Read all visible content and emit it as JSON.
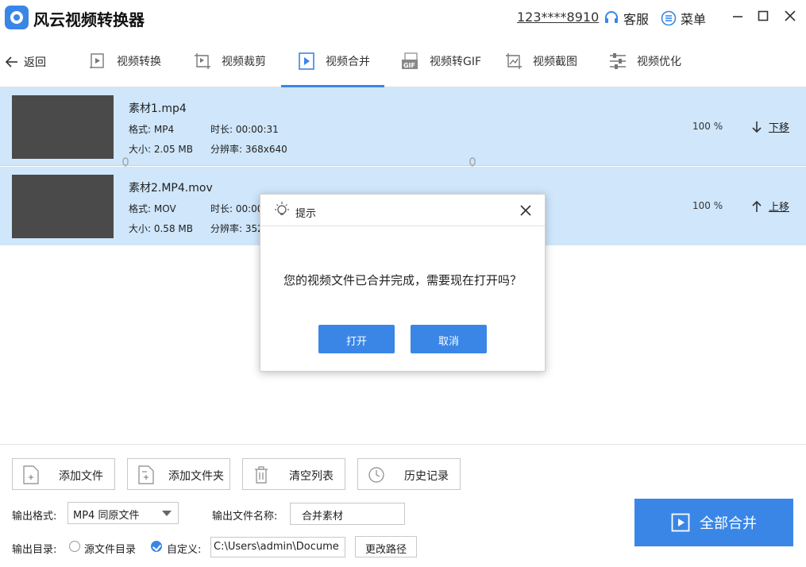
{
  "app": {
    "title": "风云视频转换器",
    "account": "123****8910",
    "service": "客服",
    "menu": "菜单"
  },
  "nav": {
    "back": "返回",
    "tabs": [
      {
        "label": "视频转换",
        "icon": "video-convert-icon"
      },
      {
        "label": "视频裁剪",
        "icon": "video-crop-icon"
      },
      {
        "label": "视频合并",
        "icon": "video-merge-icon",
        "active": true
      },
      {
        "label": "视频转GIF",
        "icon": "gif-icon"
      },
      {
        "label": "视频截图",
        "icon": "screenshot-icon"
      },
      {
        "label": "视频优化",
        "icon": "optimize-icon"
      }
    ]
  },
  "files": [
    {
      "name": "素材1.mp4",
      "format": "格式: MP4",
      "duration": "时长: 00:00:31",
      "size": "大小: 2.05 MB",
      "resolution": "分辨率: 368x640",
      "progress": "100 %",
      "move": "下移"
    },
    {
      "name": "素材2.MP4.mov",
      "format": "格式: MOV",
      "duration": "时长: 00:00",
      "size": "大小: 0.58 MB",
      "resolution": "分辨率: 352",
      "progress": "100 %",
      "move": "上移"
    }
  ],
  "toolbar": {
    "add_file": "添加文件",
    "add_folder": "添加文件夹",
    "clear": "清空列表",
    "history": "历史记录"
  },
  "output": {
    "format_label": "输出格式:",
    "format_value": "MP4 同原文件",
    "name_label": "输出文件名称:",
    "name_value": "合并素材",
    "dir_label": "输出目录:",
    "opt_source": "源文件目录",
    "opt_custom": "自定义:",
    "path_value": "C:\\Users\\admin\\Docume",
    "change_path": "更改路径"
  },
  "merge_all": "全部合并",
  "dialog": {
    "title": "提示",
    "message": "您的视频文件已合并完成，需要现在打开吗？",
    "open": "打开",
    "cancel": "取消"
  },
  "colors": {
    "accent": "#3a86e6",
    "row_bg": "#cfe6fb",
    "thumb": "#4a4a4a"
  }
}
